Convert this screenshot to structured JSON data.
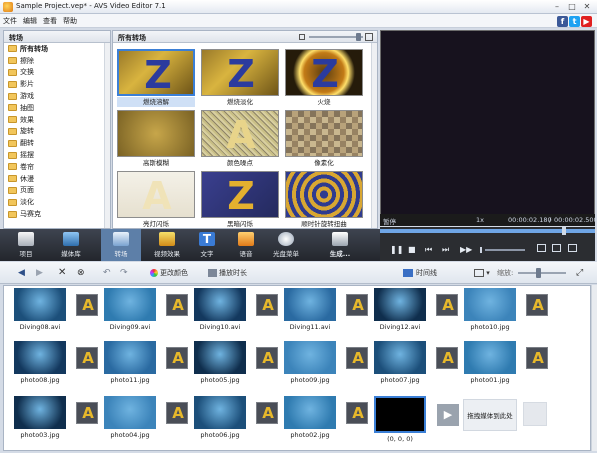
{
  "window": {
    "title": "Sample Project.vep* - AVS Video Editor 7.1"
  },
  "menu": [
    "文件",
    "编辑",
    "查看",
    "帮助"
  ],
  "social": [
    {
      "icon": "facebook-icon",
      "glyph": "f",
      "color": "#3b5998"
    },
    {
      "icon": "twitter-icon",
      "glyph": "t",
      "color": "#1da1f2"
    },
    {
      "icon": "youtube-icon",
      "glyph": "▶",
      "color": "#e02020"
    }
  ],
  "tree": {
    "header": "转场",
    "items": [
      "所有转场",
      "擦除",
      "交换",
      "影片",
      "游戏",
      "抽图",
      "效果",
      "旋转",
      "翻转",
      "摇摆",
      "卷帘",
      "休漫",
      "页面",
      "淡化",
      "马赛克"
    ]
  },
  "gallery": {
    "header": "所有转场",
    "items": [
      {
        "label": "燃烧溶解",
        "style": "z-blue"
      },
      {
        "label": "燃烧淡化",
        "style": "z-blue"
      },
      {
        "label": "火烧",
        "style": "z-fire"
      },
      {
        "label": "高斯模糊",
        "style": "blur"
      },
      {
        "label": "颜色噪点",
        "style": "noise"
      },
      {
        "label": "像素化",
        "style": "pixel"
      },
      {
        "label": "亮灯闪烁",
        "style": "a-light"
      },
      {
        "label": "黑暗闪烁",
        "style": "z-dark"
      },
      {
        "label": "顺时针旋转扭曲",
        "style": "swirl"
      }
    ]
  },
  "preview": {
    "status": "暂停",
    "speed": "1x",
    "time_current": "00:00:02.180",
    "time_total": "00:00:02.500"
  },
  "toolbar": [
    "项目",
    "媒体库",
    "转场",
    "视频效果",
    "文字",
    "语音",
    "光盘菜单",
    "生成..."
  ],
  "lowbar": {
    "change_color": "更改颜色",
    "play_duration": "播放时长",
    "timeline": "时间线",
    "zoom": "缩放:"
  },
  "media": {
    "row1": [
      "Diving08.avi",
      "Diving09.avi",
      "Diving10.avi",
      "Diving11.avi",
      "Diving12.avi",
      "photo10.jpg"
    ],
    "row2": [
      "photo08.jpg",
      "photo11.jpg",
      "photo05.jpg",
      "photo09.jpg",
      "photo07.jpg",
      "photo01.jpg"
    ],
    "row3": [
      "photo03.jpg",
      "photo04.jpg",
      "photo06.jpg",
      "photo02.jpg",
      "(0, 0, 0)"
    ],
    "drop_hint": "拖拽媒体到此处"
  }
}
